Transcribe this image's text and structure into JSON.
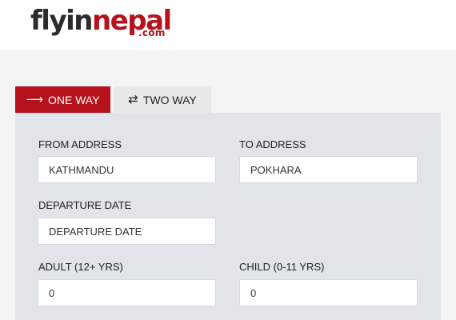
{
  "brand": {
    "logo_part1": "flyin",
    "logo_part2": "nepal",
    "logo_domain": ".com"
  },
  "tabs": [
    {
      "label": "ONE WAY",
      "icon": "arrow-right-icon",
      "active": true
    },
    {
      "label": "TWO WAY",
      "icon": "swap-arrows-icon",
      "active": false
    }
  ],
  "form": {
    "from": {
      "label": "FROM ADDRESS",
      "value": "KATHMANDU"
    },
    "to": {
      "label": "TO ADDRESS",
      "value": "POKHARA"
    },
    "departure": {
      "label": "DEPARTURE DATE",
      "placeholder": "DEPARTURE DATE"
    },
    "adult": {
      "label": "ADULT (12+ YRS)",
      "value": "0"
    },
    "child": {
      "label": "CHILD (0-11 YRS)",
      "value": "0"
    }
  },
  "colors": {
    "brand_red": "#b5121b",
    "panel_bg": "#e1e4e8",
    "inactive_tab": "#e9e9ea"
  }
}
